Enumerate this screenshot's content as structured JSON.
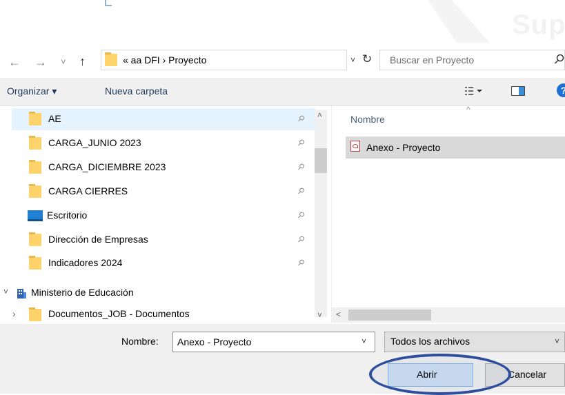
{
  "colors": {
    "accent": "#2e4d9c",
    "folder": "#ffd36b",
    "selection": "#e5f3ff",
    "file_selected": "#d9d9d9",
    "help": "#1e6fd4",
    "pdf": "#d03a3a"
  },
  "watermark": {
    "text": "Sup"
  },
  "nav": {
    "back_icon": "arrow-left-icon",
    "forward_icon": "arrow-right-icon",
    "recent_icon": "chevron-down-icon",
    "up_icon": "arrow-up-icon",
    "address": "« aa DFI › Proyecto",
    "refresh_icon": "refresh-icon",
    "search_placeholder": "Buscar en Proyecto"
  },
  "toolbar": {
    "organize": "Organizar ▾",
    "new_folder": "Nueva carpeta",
    "view_icon": "view-options-icon",
    "preview_icon": "preview-pane-icon",
    "help": "?"
  },
  "left_pane": {
    "items": [
      {
        "label": "AE",
        "icon": "folder-icon",
        "pinned": true,
        "selected": true
      },
      {
        "label": "CARGA_JUNIO 2023",
        "icon": "folder-icon",
        "pinned": true
      },
      {
        "label": "CARGA_DICIEMBRE 2023",
        "icon": "folder-icon",
        "pinned": true
      },
      {
        "label": "CARGA CIERRES",
        "icon": "folder-icon",
        "pinned": true
      },
      {
        "label": "Escritorio",
        "icon": "desktop-icon",
        "pinned": true
      },
      {
        "label": "Dirección de Empresas",
        "icon": "folder-icon",
        "pinned": true
      },
      {
        "label": "Indicadores 2024",
        "icon": "folder-icon",
        "pinned": true
      },
      {
        "label": "Ministerio de Educación",
        "icon": "building-icon",
        "expanded": true
      },
      {
        "label": "Documentos_JOB - Documentos",
        "icon": "folder-icon",
        "expanded": false
      }
    ]
  },
  "right_pane": {
    "column": "Nombre",
    "files": [
      {
        "label": "Anexo - Proyecto",
        "icon": "pdf-icon",
        "selected": true
      }
    ]
  },
  "bottom": {
    "name_label": "Nombre:",
    "name_value": "Anexo - Proyecto",
    "file_type": "Todos los archivos",
    "open": "Abrir",
    "cancel": "Cancelar"
  },
  "glyphs": {
    "back": "←",
    "forward": "→",
    "recent": "˅",
    "up": "↑",
    "dropdown": "˅",
    "refresh": "↻",
    "pin": "⚲",
    "scroll_up": "˄",
    "scroll_down": "˅",
    "scroll_left": "<",
    "expanded": "˅",
    "collapsed": "›",
    "sort": "^"
  }
}
